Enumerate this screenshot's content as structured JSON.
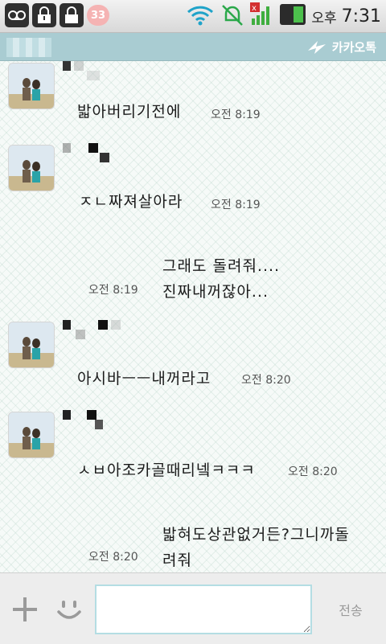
{
  "status_bar": {
    "badge": "33",
    "ampm": "오후",
    "time": "7:31"
  },
  "header": {
    "app_name": "카카오톡"
  },
  "messages": [
    {
      "side": "left",
      "text": "밟아버리기전에",
      "time": "오전 8:19"
    },
    {
      "side": "left",
      "text": "ㅈㄴ짜져살아라",
      "time": "오전 8:19"
    },
    {
      "side": "right",
      "lines": [
        "그래도 돌려줘....",
        "진짜내꺼잖아..."
      ],
      "time": "오전 8:19"
    },
    {
      "side": "left",
      "text": "아시바ㅡㅡ내꺼라고",
      "time": "오전 8:20"
    },
    {
      "side": "left",
      "text": "ㅅㅂ아조카골때리넼ㅋㅋㅋ",
      "time": "오전 8:20"
    },
    {
      "side": "right",
      "lines": [
        "밟혀도상관없거든?그니까돌",
        "려줘"
      ],
      "time": "오전 8:20"
    }
  ],
  "input_bar": {
    "send_label": "전송",
    "placeholder": ""
  }
}
